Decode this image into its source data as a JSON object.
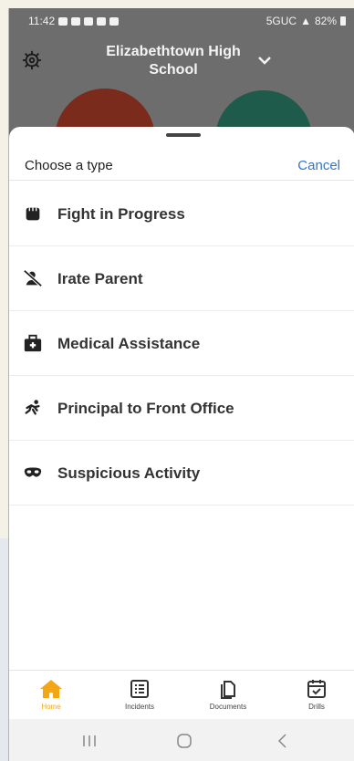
{
  "status_bar": {
    "time": "11:42",
    "network": "5GUC",
    "battery": "82%"
  },
  "header": {
    "school_name": "Elizabethtown High School"
  },
  "sheet": {
    "title": "Choose a type",
    "cancel_label": "Cancel",
    "items": [
      {
        "label": "Fight in Progress",
        "icon": "fist-icon"
      },
      {
        "label": "Irate Parent",
        "icon": "user-slash-icon"
      },
      {
        "label": "Medical Assistance",
        "icon": "medical-kit-icon"
      },
      {
        "label": "Principal to Front Office",
        "icon": "running-person-icon"
      },
      {
        "label": "Suspicious Activity",
        "icon": "mask-icon"
      }
    ]
  },
  "tabs": [
    {
      "label": "Home",
      "icon": "home-icon",
      "active": true
    },
    {
      "label": "Incidents",
      "icon": "list-icon",
      "active": false
    },
    {
      "label": "Documents",
      "icon": "documents-icon",
      "active": false
    },
    {
      "label": "Drills",
      "icon": "calendar-check-icon",
      "active": false
    }
  ],
  "colors": {
    "accent": "#2f77c9",
    "active_tab": "#f4a619"
  }
}
